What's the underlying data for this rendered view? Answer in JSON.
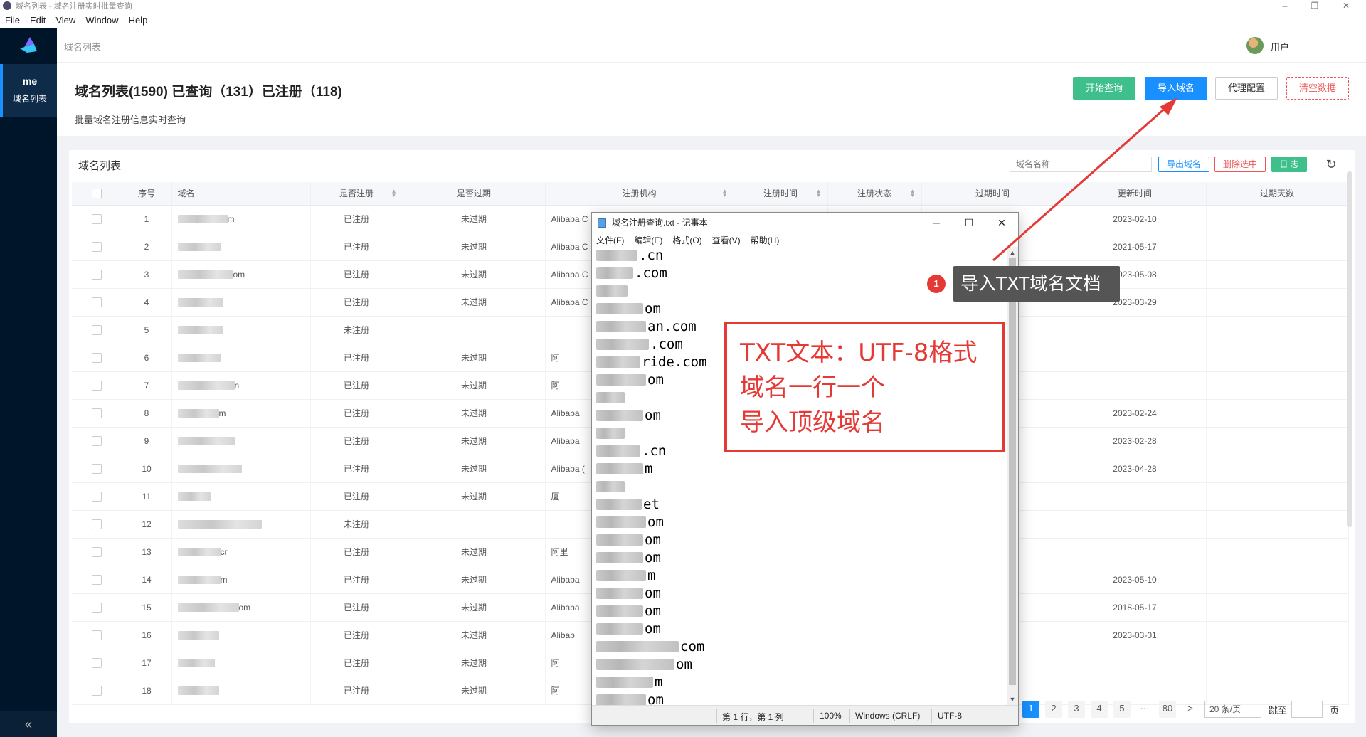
{
  "window": {
    "title": "域名列表 - 域名注册实时批量查询",
    "menu": [
      "File",
      "Edit",
      "View",
      "Window",
      "Help"
    ]
  },
  "sidebar": {
    "item_title": "me",
    "item_label": "域名列表",
    "collapse_glyph": "«"
  },
  "header": {
    "breadcrumb": "域名列表",
    "user": "用户"
  },
  "page": {
    "title": "域名列表(1590) 已查询（131）已注册（118)",
    "subtitle": "批量域名注册信息实时查询",
    "buttons": {
      "start": "开始查询",
      "import": "导入域名",
      "proxy": "代理配置",
      "clear": "清空数据"
    }
  },
  "card": {
    "title": "域名列表",
    "search_placeholder": "域名名称",
    "export": "导出域名",
    "delete_selected": "删除选中",
    "log": "日 志",
    "refresh_glyph": "↻"
  },
  "table": {
    "columns": [
      "",
      "序号",
      "域名",
      "是否注册",
      "是否过期",
      "注册机构",
      "注册时间",
      "注册状态",
      "过期时间",
      "更新时间",
      "过期天数"
    ],
    "rows": [
      {
        "no": "1",
        "domain_tail": "m",
        "reg": "已注册",
        "exp": "未过期",
        "registrar": "Alibaba C",
        "updated": "2023-02-10"
      },
      {
        "no": "2",
        "domain_tail": "",
        "reg": "已注册",
        "exp": "未过期",
        "registrar": "Alibaba C",
        "updated": "2021-05-17"
      },
      {
        "no": "3",
        "domain_tail": "om",
        "reg": "已注册",
        "exp": "未过期",
        "registrar": "Alibaba C",
        "updated": "2023-05-08"
      },
      {
        "no": "4",
        "domain_tail": "",
        "reg": "已注册",
        "exp": "未过期",
        "registrar": "Alibaba C",
        "updated": "2023-03-29"
      },
      {
        "no": "5",
        "domain_tail": "",
        "reg": "未注册",
        "exp": "",
        "registrar": "",
        "updated": ""
      },
      {
        "no": "6",
        "domain_tail": "",
        "reg": "已注册",
        "exp": "未过期",
        "registrar": "阿",
        "updated": ""
      },
      {
        "no": "7",
        "domain_tail": "n",
        "reg": "已注册",
        "exp": "未过期",
        "registrar": "阿",
        "updated": ""
      },
      {
        "no": "8",
        "domain_tail": "m",
        "reg": "已注册",
        "exp": "未过期",
        "registrar": "Alibaba",
        "updated": "2023-02-24"
      },
      {
        "no": "9",
        "domain_tail": "",
        "reg": "已注册",
        "exp": "未过期",
        "registrar": "Alibaba",
        "updated": "2023-02-28"
      },
      {
        "no": "10",
        "domain_tail": "",
        "reg": "已注册",
        "exp": "未过期",
        "registrar": "Alibaba (",
        "updated": "2023-04-28"
      },
      {
        "no": "11",
        "domain_tail": "",
        "reg": "已注册",
        "exp": "未过期",
        "registrar": "厦",
        "updated": ""
      },
      {
        "no": "12",
        "domain_tail": "",
        "reg": "未注册",
        "exp": "",
        "registrar": "",
        "updated": ""
      },
      {
        "no": "13",
        "domain_tail": "cr",
        "reg": "已注册",
        "exp": "未过期",
        "registrar": "阿里",
        "updated": ""
      },
      {
        "no": "14",
        "domain_tail": "m",
        "reg": "已注册",
        "exp": "未过期",
        "registrar": "Alibaba",
        "updated": "2023-05-10"
      },
      {
        "no": "15",
        "domain_tail": "om",
        "reg": "已注册",
        "exp": "未过期",
        "registrar": "Alibaba",
        "updated": "2018-05-17"
      },
      {
        "no": "16",
        "domain_tail": "",
        "reg": "已注册",
        "exp": "未过期",
        "registrar": "Alibab",
        "updated": "2023-03-01"
      },
      {
        "no": "17",
        "domain_tail": "",
        "reg": "已注册",
        "exp": "未过期",
        "registrar": "阿",
        "updated": ""
      },
      {
        "no": "18",
        "domain_tail": "",
        "reg": "已注册",
        "exp": "未过期",
        "registrar": "阿",
        "updated": ""
      }
    ]
  },
  "pagination": {
    "pages": [
      "1",
      "2",
      "3",
      "4",
      "5"
    ],
    "ellipsis": "···",
    "last": "80",
    "next": ">",
    "page_size": "20 条/页",
    "jump_label": "跳至",
    "page_suffix": "页"
  },
  "notepad": {
    "title": "域名注册查询.txt - 记事本",
    "menu": [
      "文件(F)",
      "编辑(E)",
      "格式(O)",
      "查看(V)",
      "帮助(H)"
    ],
    "lines": [
      ".cn",
      ".com",
      "",
      "om",
      "an.com",
      ".com",
      "ride.com",
      "om",
      "",
      "om",
      "",
      ".cn",
      "m",
      "",
      "et",
      "om",
      "om",
      "om",
      "m",
      "om",
      "om",
      "om",
      "com",
      "om",
      "m",
      "om"
    ],
    "status": {
      "position": "第 1 行，第 1 列",
      "zoom": "100%",
      "eol": "Windows (CRLF)",
      "encoding": "UTF-8"
    }
  },
  "annotations": {
    "badge": "1",
    "tip": "导入TXT域名文档",
    "note_lines": [
      "TXT文本：UTF-8格式",
      "域名一行一个",
      "导入顶级域名"
    ]
  },
  "colors": {
    "primary": "#1890ff",
    "success": "#3fbf8c",
    "danger": "#e53935",
    "sidebar": "#001529"
  }
}
